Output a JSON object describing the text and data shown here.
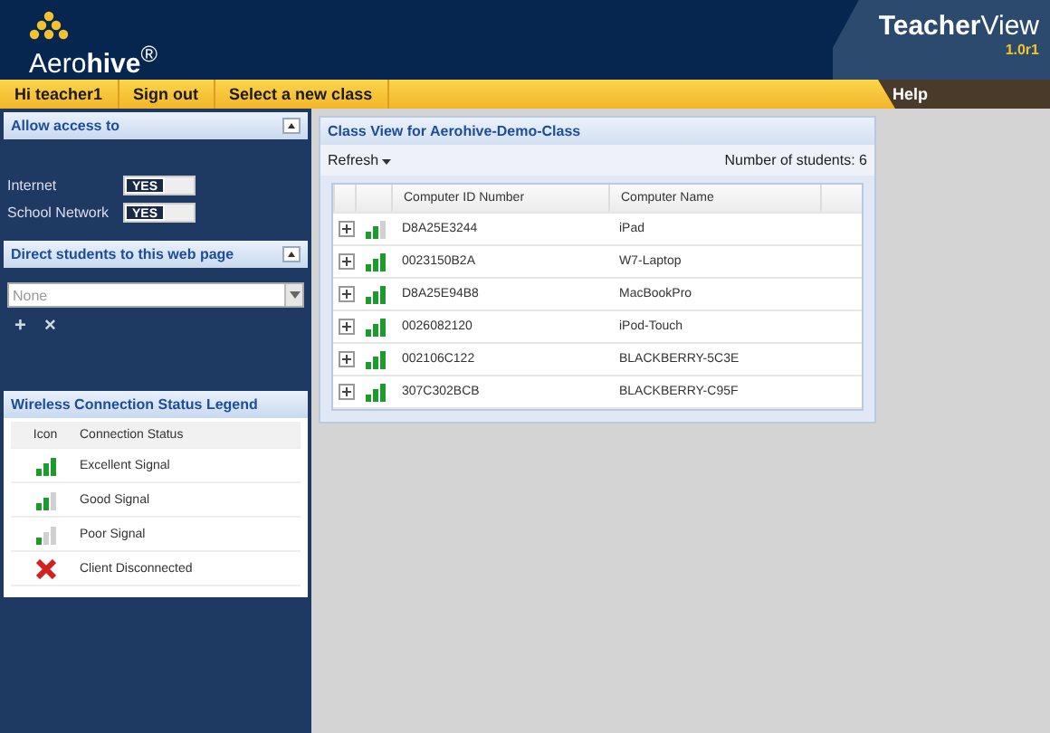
{
  "header": {
    "logo": "Aero**hive**$^{®}$",
    "product": "**Teacher**View",
    "version": "1.0r1"
  },
  "nav": {
    "items": [
      "Hi teacher1",
      "Sign out",
      "Select a new class"
    ],
    "help": "Help"
  },
  "access_panel": {
    "title": "Allow access to",
    "expanded": true,
    "toggles": [
      {
        "label": "Internet",
        "state_text": "YES",
        "on": true
      },
      {
        "label": "School Network",
        "state_text": "YES",
        "on": true
      }
    ]
  },
  "direct_panel": {
    "title": "Direct students to this web page",
    "expanded": true,
    "select": {
      "value": "None"
    },
    "add": "+",
    "remove": "×"
  },
  "legend": {
    "title": "Wireless Connection Status Legend",
    "columns": [
      "Icon",
      "Connection Status"
    ],
    "rows": [
      {
        "kind": "excellent",
        "label": "Excellent Signal"
      },
      {
        "kind": "good",
        "label": "Good Signal"
      },
      {
        "kind": "poor",
        "label": "Poor Signal"
      },
      {
        "kind": "disconnected",
        "label": "Client Disconnected"
      }
    ]
  },
  "class_view": {
    "title": "Class View for Aerohive-Demo-Class",
    "refresh": "Refresh",
    "student_count": "Number of students: 6",
    "columns": [
      "Computer ID Number",
      "Computer Name"
    ],
    "rows": [
      {
        "kind": "good",
        "id": "D8A25E3244",
        "name": "iPad"
      },
      {
        "kind": "excellent",
        "id": "0023150B2A",
        "name": "W7-Laptop"
      },
      {
        "kind": "excellent",
        "id": "D8A25E94B8",
        "name": "MacBookPro"
      },
      {
        "kind": "excellent",
        "id": "0026082120",
        "name": "iPod-Touch"
      },
      {
        "kind": "excellent",
        "id": "002106C122",
        "name": "BLACKBERRY-5C3E"
      },
      {
        "kind": "excellent",
        "id": "307C302BCB",
        "name": "BLACKBERRY-C95F"
      }
    ]
  }
}
